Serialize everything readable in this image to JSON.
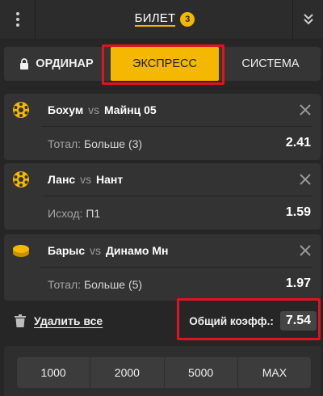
{
  "header": {
    "title": "БИЛЕТ",
    "count": "3"
  },
  "tabs": [
    {
      "label": "ОРДИНАР",
      "icon": "lock-icon"
    },
    {
      "label": "ЭКСПРЕСС",
      "active": true
    },
    {
      "label": "СИСТЕМА"
    }
  ],
  "bets": [
    {
      "home": "Бохум",
      "vs": "vs",
      "away": "Майнц 05",
      "market": "Тотал:",
      "selection": "Больше (3)",
      "odds": "2.41",
      "sport_icon": "football-icon"
    },
    {
      "home": "Ланс",
      "vs": "vs",
      "away": "Нант",
      "market": "Исход:",
      "selection": "П1",
      "odds": "1.59",
      "sport_icon": "football-icon"
    },
    {
      "home": "Барыс",
      "vs": "vs",
      "away": "Динамо Мн",
      "market": "Тотал:",
      "selection": "Больше (5)",
      "odds": "1.97",
      "sport_icon": "hockey-puck-icon"
    }
  ],
  "footer": {
    "delete_all": "Удалить все",
    "total_label": "Общий коэфф.:",
    "total_value": "7.54"
  },
  "stakes": [
    "1000",
    "2000",
    "5000",
    "MAX"
  ],
  "colors": {
    "accent": "#f5b800",
    "highlight": "#e0141e",
    "background": "#262626",
    "card": "#333333"
  }
}
